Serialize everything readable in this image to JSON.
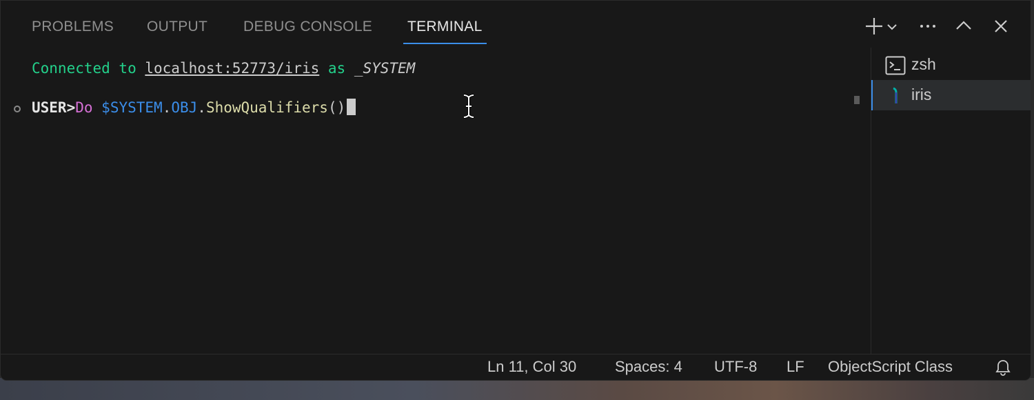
{
  "panel": {
    "tabs": [
      {
        "label": "PROBLEMS",
        "active": false
      },
      {
        "label": "OUTPUT",
        "active": false
      },
      {
        "label": "DEBUG CONSOLE",
        "active": false
      },
      {
        "label": "TERMINAL",
        "active": true
      }
    ],
    "actions": [
      "plus-icon",
      "chevron-down-icon",
      "more-icon",
      "chevron-up-icon",
      "close-icon"
    ]
  },
  "terminal": {
    "line1": {
      "prefix": "Connected to ",
      "host": "localhost:52773/iris",
      "middle": " as ",
      "user": "_SYSTEM"
    },
    "line2": {
      "prompt": "USER>",
      "command": "Do",
      "space": " ",
      "sysvar": "$SYSTEM",
      "dot1": ".",
      "obj": "OBJ",
      "dot2": ".",
      "method": "ShowQualifiers",
      "parens": "()"
    }
  },
  "terminal_list": [
    {
      "label": "zsh",
      "icon": "terminal-icon",
      "selected": false
    },
    {
      "label": "iris",
      "icon": "iris-icon",
      "selected": true
    }
  ],
  "statusbar": {
    "position": "Ln 11, Col 30",
    "spaces": "Spaces: 4",
    "encoding": "UTF-8",
    "eol": "LF",
    "language": "ObjectScript Class",
    "bell_icon": "bell-icon"
  },
  "colors": {
    "background": "#181818",
    "accent": "#3b8eea",
    "green": "#23d18b",
    "magenta": "#d670d6",
    "yellow": "#dcdcaa"
  }
}
